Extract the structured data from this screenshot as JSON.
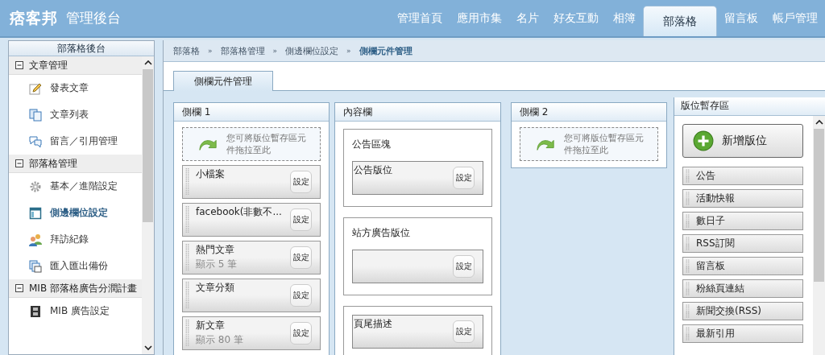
{
  "header": {
    "logo": "痞客邦",
    "subtitle": "管理後台",
    "nav": [
      {
        "label": "管理首頁",
        "selected": false
      },
      {
        "label": "應用市集",
        "selected": false
      },
      {
        "label": "名片",
        "selected": false
      },
      {
        "label": "好友互動",
        "selected": false
      },
      {
        "label": "相簿",
        "selected": false
      },
      {
        "label": "部落格",
        "selected": true
      },
      {
        "label": "留言板",
        "selected": false
      },
      {
        "label": "帳戶管理",
        "selected": false
      }
    ]
  },
  "sidebar": {
    "title": "部落格後台",
    "groups": [
      {
        "label": "文章管理",
        "expanded": true,
        "items": [
          {
            "label": "發表文章",
            "selected": false
          },
          {
            "label": "文章列表",
            "selected": false
          },
          {
            "label": "留言／引用管理",
            "selected": false
          }
        ]
      },
      {
        "label": "部落格管理",
        "expanded": true,
        "items": [
          {
            "label": "基本／進階設定",
            "selected": false
          },
          {
            "label": "側邊欄位設定",
            "selected": true
          },
          {
            "label": "拜訪紀錄",
            "selected": false
          },
          {
            "label": "匯入匯出備份",
            "selected": false
          }
        ]
      },
      {
        "label": "MIB 部落格廣告分潤計畫",
        "expanded": true,
        "items": [
          {
            "label": "MIB 廣告設定",
            "selected": false
          }
        ]
      }
    ]
  },
  "breadcrumb": [
    "部落格",
    "部落格管理",
    "側邊欄位設定",
    "側欄元件管理"
  ],
  "breadcrumb_separator": "»",
  "tabs": [
    {
      "label": "側欄元件管理",
      "selected": true
    }
  ],
  "columns": [
    {
      "kind": "sidebar",
      "title": "側欄 1",
      "drop_hint": "您可將版位暫存區元件拖拉至此",
      "widgets": [
        {
          "name": "小檔案",
          "button": "設定"
        },
        {
          "name": "facebook(非數不...",
          "button": "設定"
        },
        {
          "name": "熱門文章",
          "detail": "顯示 5 筆",
          "button": "設定"
        },
        {
          "name": "文章分類",
          "button": "設定"
        },
        {
          "name": "新文章",
          "detail": "顯示 80 筆",
          "button": "設定"
        }
      ]
    },
    {
      "kind": "content",
      "title": "內容欄",
      "sections": [
        {
          "title": "公告區塊",
          "widget": {
            "name": "公告版位",
            "button": "設定"
          }
        },
        {
          "title": "站方廣告版位",
          "widget": {
            "button": "設定"
          }
        },
        {
          "widget": {
            "name": "頁尾描述",
            "button": "設定"
          }
        }
      ]
    },
    {
      "kind": "sidebar",
      "title": "側欄 2",
      "drop_hint": "您可將版位暫存區元件拖拉至此"
    }
  ],
  "staging": {
    "title": "版位暫存區",
    "add_button": "新增版位",
    "items": [
      "公告",
      "活動快報",
      "數日子",
      "RSS訂閱",
      "留言板",
      "粉絲頁連結",
      "新聞交換(RSS)",
      "最新引用"
    ]
  }
}
